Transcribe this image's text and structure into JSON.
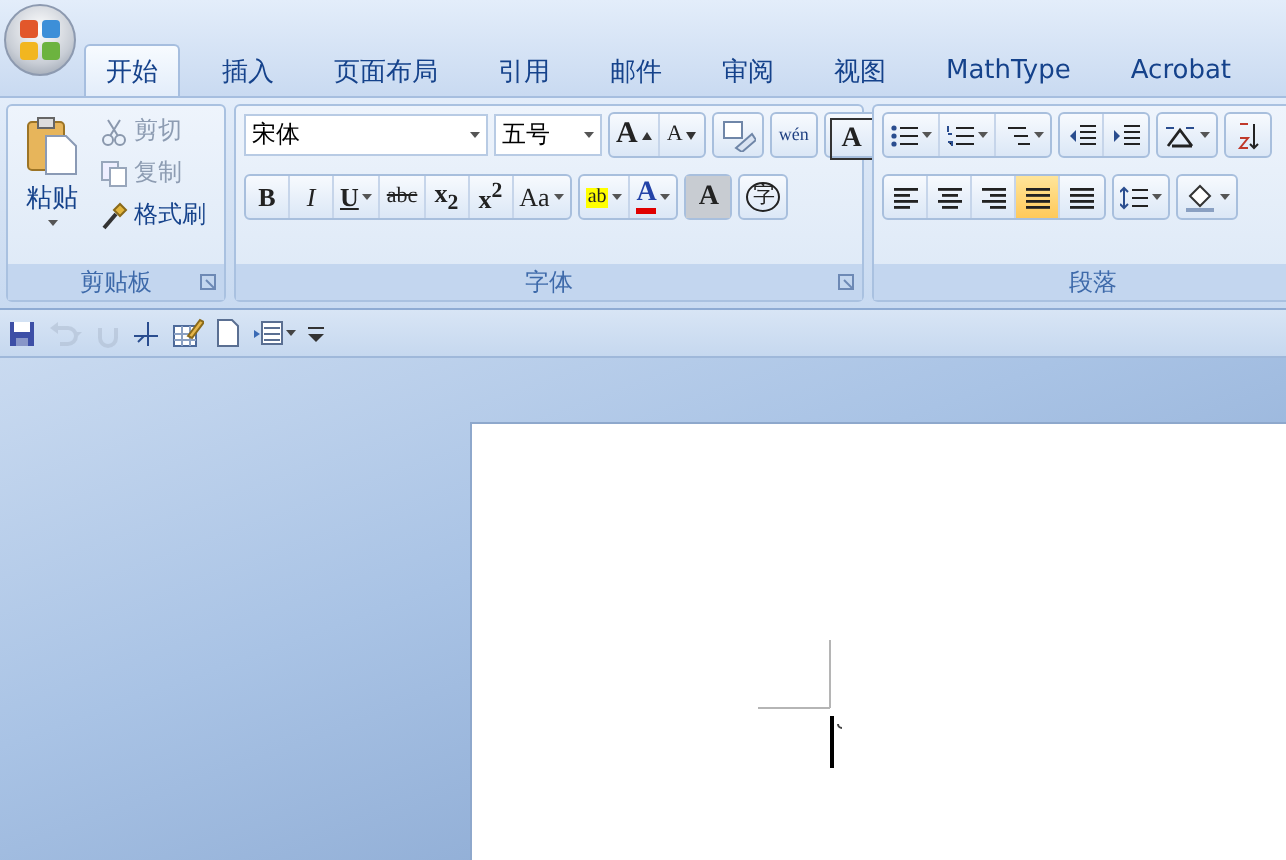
{
  "tabs": [
    {
      "label": "开始",
      "selected": true
    },
    {
      "label": "插入",
      "selected": false
    },
    {
      "label": "页面布局",
      "selected": false
    },
    {
      "label": "引用",
      "selected": false
    },
    {
      "label": "邮件",
      "selected": false
    },
    {
      "label": "审阅",
      "selected": false
    },
    {
      "label": "视图",
      "selected": false
    },
    {
      "label": "MathType",
      "selected": false
    },
    {
      "label": "Acrobat",
      "selected": false
    }
  ],
  "clipboard": {
    "paste": "粘贴",
    "items": [
      {
        "kind": "cut",
        "label": "剪切",
        "disabled": true
      },
      {
        "kind": "copy",
        "label": "复制",
        "disabled": true
      },
      {
        "kind": "painter",
        "label": "格式刷",
        "disabled": false
      }
    ],
    "label": "剪贴板"
  },
  "font": {
    "font_name": "宋体",
    "font_size": "五号",
    "row1": [
      {
        "kind": "grow",
        "text": "A"
      },
      {
        "kind": "shrink",
        "text": "A"
      },
      {
        "kind": "clear"
      },
      {
        "kind": "phonetic",
        "text": "wén"
      },
      {
        "kind": "border",
        "text": "A"
      }
    ],
    "row2": [
      {
        "kind": "bold",
        "text": "B"
      },
      {
        "kind": "italic",
        "text": "I"
      },
      {
        "kind": "underline",
        "text": "U"
      },
      {
        "kind": "strike",
        "text": "abc"
      },
      {
        "kind": "subscript",
        "text": "x$_{2}$"
      },
      {
        "kind": "superscript",
        "text": "x$^{2}$"
      },
      {
        "kind": "case",
        "text": "Aa"
      },
      {
        "kind": "highlight",
        "text": "ab"
      },
      {
        "kind": "fontcolor",
        "text": "A"
      },
      {
        "kind": "shade",
        "text": "A"
      },
      {
        "kind": "enclose",
        "text": "字"
      }
    ],
    "label": "字体"
  },
  "paragraph": {
    "align": [
      {
        "kind": "left",
        "selected": false
      },
      {
        "kind": "center",
        "selected": false
      },
      {
        "kind": "right",
        "selected": false
      },
      {
        "kind": "justify",
        "selected": true
      },
      {
        "kind": "distributed",
        "selected": false
      }
    ],
    "label": "段落"
  },
  "quick_access": [
    {
      "kind": "save",
      "disabled": false
    },
    {
      "kind": "undo",
      "disabled": true
    },
    {
      "kind": "redo",
      "disabled": true
    },
    {
      "kind": "draw",
      "disabled": false
    },
    {
      "kind": "table",
      "disabled": false
    },
    {
      "kind": "new",
      "disabled": false
    },
    {
      "kind": "layout",
      "disabled": false
    },
    {
      "kind": "more",
      "disabled": false
    }
  ]
}
